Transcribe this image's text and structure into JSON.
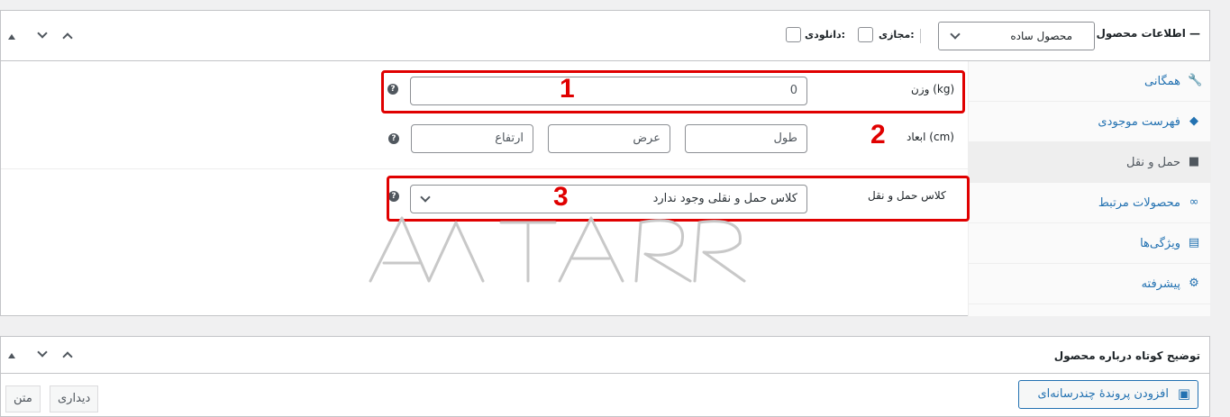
{
  "product_data": {
    "title": "اطلاعات محصول —",
    "type_select": "محصول ساده",
    "virtual_label": "مجازی:",
    "downloadable_label": "دانلودی:"
  },
  "tabs": [
    {
      "label": "همگانی",
      "icon": "wrench-icon",
      "glyph": "🔧"
    },
    {
      "label": "فهرست موجودی",
      "icon": "tag-icon",
      "glyph": "◆"
    },
    {
      "label": "حمل و نقل",
      "icon": "truck-icon",
      "glyph": "■"
    },
    {
      "label": "محصولات مرتبط",
      "icon": "link-icon",
      "glyph": "∞"
    },
    {
      "label": "ویژگی‌ها",
      "icon": "list-icon",
      "glyph": "▤"
    },
    {
      "label": "پیشرفته",
      "icon": "gear-icon",
      "glyph": "⚙"
    }
  ],
  "shipping": {
    "weight_label": "وزن (kg)",
    "weight_value": "0",
    "dimensions_label": "ابعاد (cm)",
    "length_placeholder": "طول",
    "width_placeholder": "عرض",
    "height_placeholder": "ارتفاع",
    "class_label": "کلاس حمل و نقل",
    "class_value": "کلاس حمل و نقلی وجود ندارد",
    "help": "?"
  },
  "annotations": [
    "1",
    "2",
    "3"
  ],
  "short_desc": {
    "title": "توضیح کوتاه درباره محصول",
    "add_media": "افزودن پروندهٔ چندرسانه‌ای",
    "visual_tab": "دیداری",
    "text_tab": "متن"
  },
  "colors": {
    "accent": "#2271b1",
    "annotation": "#e00000"
  }
}
